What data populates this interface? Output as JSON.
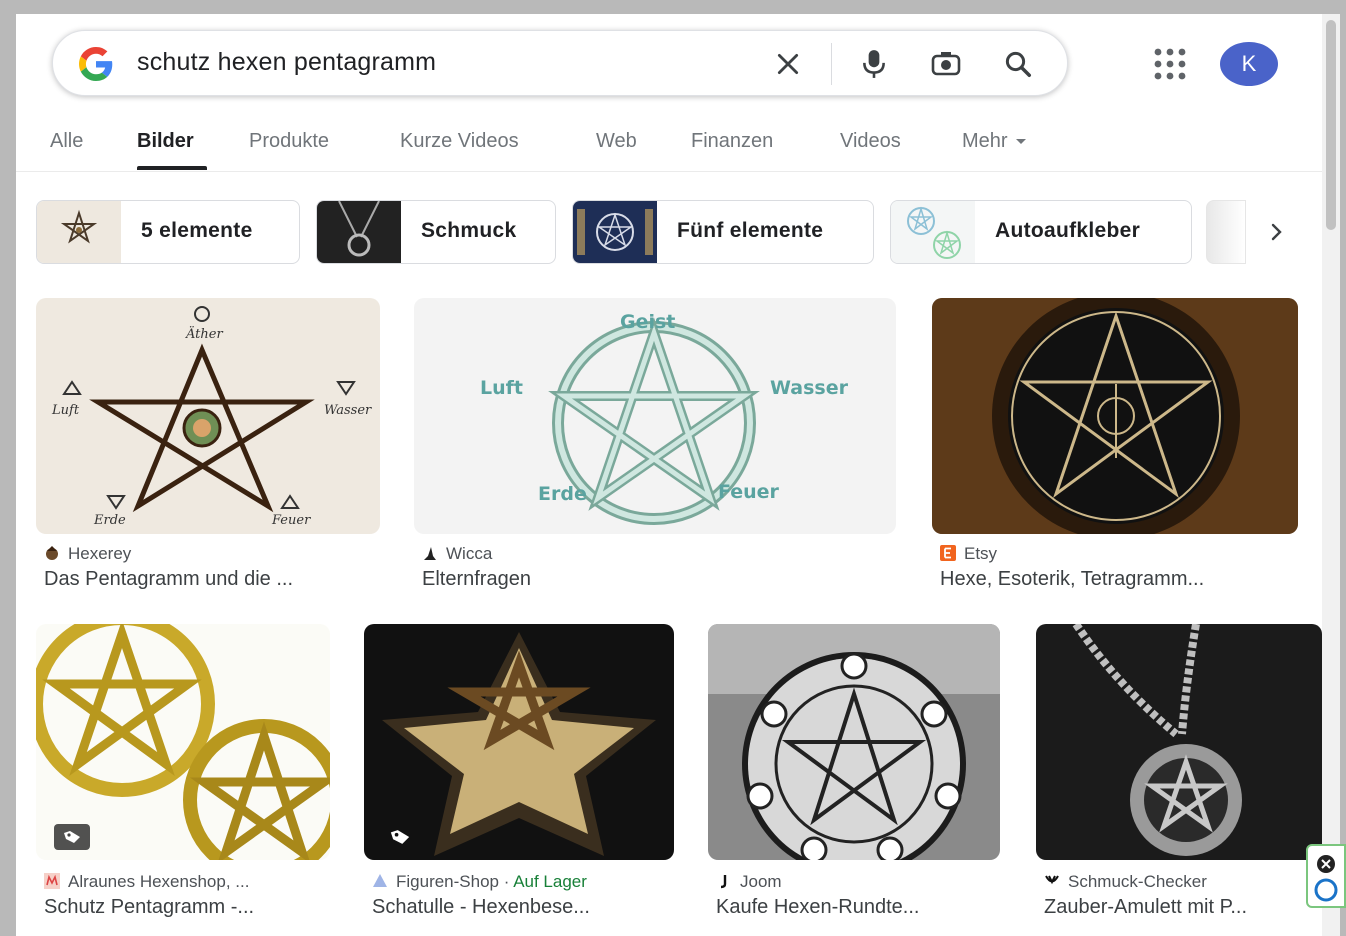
{
  "search": {
    "query": "schutz hexen pentagramm"
  },
  "account": {
    "initial": "K"
  },
  "tabs": [
    {
      "label": "Alle"
    },
    {
      "label": "Bilder"
    },
    {
      "label": "Produkte"
    },
    {
      "label": "Kurze Videos"
    },
    {
      "label": "Web"
    },
    {
      "label": "Finanzen"
    },
    {
      "label": "Videos"
    },
    {
      "label": "Mehr"
    }
  ],
  "chips": [
    {
      "label": "5 elemente"
    },
    {
      "label": "Schmuck"
    },
    {
      "label": "Fünf elemente"
    },
    {
      "label": "Autoaufkleber"
    }
  ],
  "results": [
    {
      "source": "Hexerey",
      "title": "Das Pentagramm und die ...",
      "image_text": [
        "Äther",
        "Luft",
        "Wasser",
        "Erde",
        "Feuer"
      ]
    },
    {
      "source": "Wicca",
      "title": "Elternfragen",
      "image_text": [
        "Geist",
        "Luft",
        "Wasser",
        "Erde",
        "Feuer"
      ]
    },
    {
      "source": "Etsy",
      "title": "Hexe, Esoterik, Tetragramm..."
    },
    {
      "source": "Alraunes Hexenshop, ...",
      "title": "Schutz Pentagramm -..."
    },
    {
      "source": "Figuren-Shop",
      "source_extra": "Auf Lager",
      "title": "Schatulle - Hexenbese..."
    },
    {
      "source": "Joom",
      "title": "Kaufe Hexen-Rundte..."
    },
    {
      "source": "Schmuck-Checker",
      "title": "Zauber-Amulett mit P..."
    }
  ],
  "colors": {
    "avatar": "#4a63c9",
    "in_stock": "#188038",
    "etsy": "#f1641e"
  }
}
